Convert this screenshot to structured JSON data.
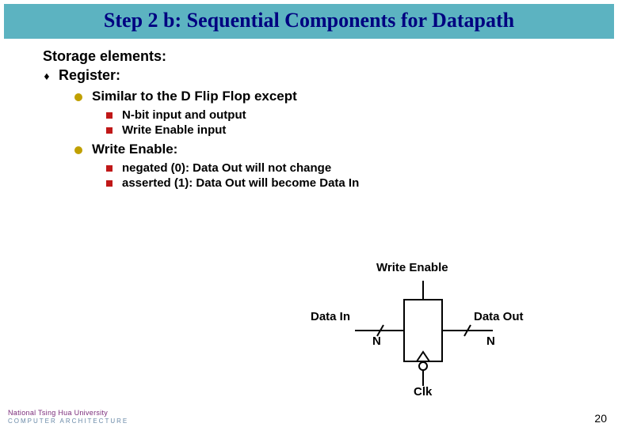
{
  "title": "Step 2 b: Sequential Components for Datapath",
  "section_heading": "Storage elements:",
  "bullets": {
    "register": "Register:",
    "similar": "Similar to the D Flip Flop except",
    "nbit": "N-bit input and output",
    "we_input": "Write Enable input",
    "we_heading": "Write Enable:",
    "negated": "negated (0): Data Out will not change",
    "asserted": "asserted (1): Data Out will become Data In"
  },
  "diagram": {
    "write_enable": "Write Enable",
    "data_in": "Data In",
    "data_out": "Data Out",
    "n_left": "N",
    "n_right": "N",
    "clk": "Clk"
  },
  "footer": {
    "university": "National Tsing Hua University",
    "dept": "COMPUTER  ARCHITECTURE"
  },
  "page_number": "20"
}
